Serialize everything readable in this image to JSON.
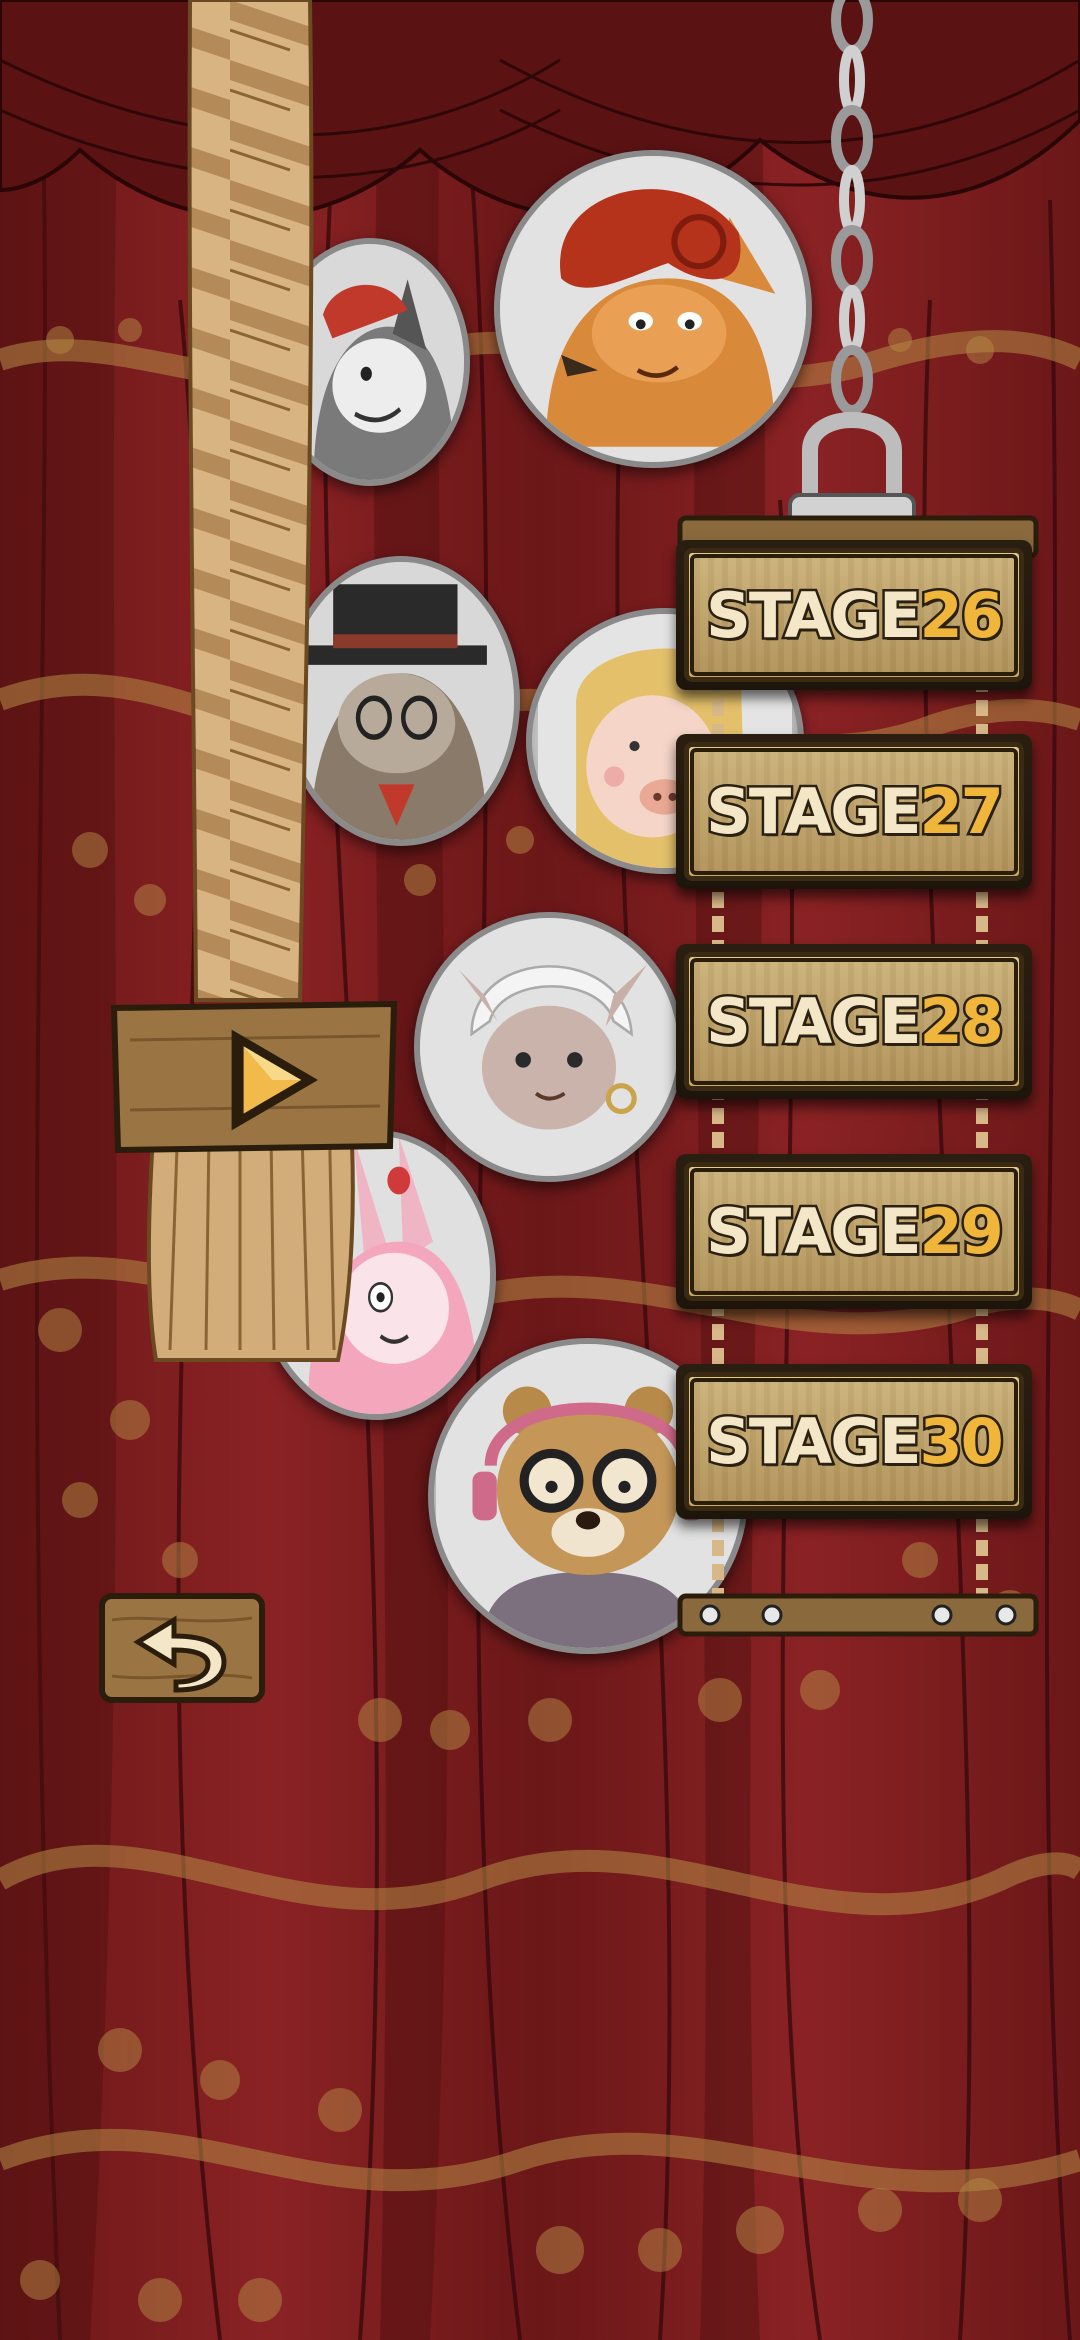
{
  "scene": "stage-select",
  "stages": [
    {
      "prefix": "STAGE",
      "number": "26"
    },
    {
      "prefix": "STAGE",
      "number": "27"
    },
    {
      "prefix": "STAGE",
      "number": "28"
    },
    {
      "prefix": "STAGE",
      "number": "29"
    },
    {
      "prefix": "STAGE",
      "number": "30"
    }
  ],
  "icons": {
    "back": "back-arrow-icon",
    "play": "play-triangle-icon"
  },
  "characters": [
    "gray-cat-with-red-cap",
    "red-haired-fox-lady",
    "raccoon-with-top-hat",
    "pig-with-blonde-hair",
    "hairless-cat-with-headscarf",
    "pink-bunny",
    "bear-with-glasses-and-headphones"
  ],
  "colors": {
    "curtain": "#7a1d1d",
    "curtain_dark": "#4d0f10",
    "pattern_gold": "#b58a45",
    "sign_wood": "#c7a964",
    "stage_number": "#f0b53b",
    "rope": "#d9b483",
    "chain": "#c8c8c8"
  }
}
